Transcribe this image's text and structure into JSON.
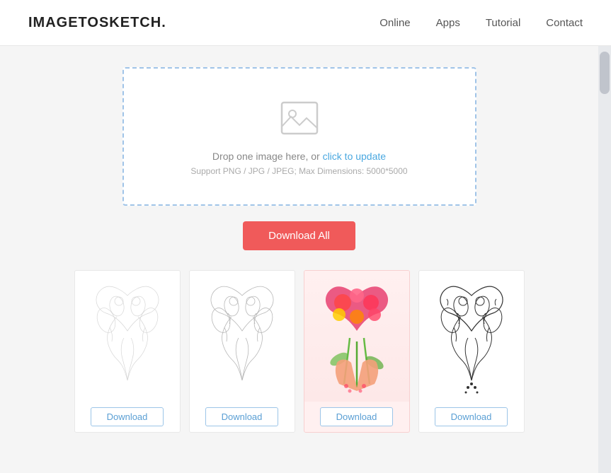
{
  "header": {
    "logo": "IMAGETOSKETCH.",
    "nav": [
      {
        "label": "Online",
        "href": "#"
      },
      {
        "label": "Apps",
        "href": "#"
      },
      {
        "label": "Tutorial",
        "href": "#"
      },
      {
        "label": "Contact",
        "href": "#"
      }
    ]
  },
  "dropzone": {
    "main_text": "Drop one image here, or ",
    "link_text": "click to update",
    "sub_text": "Support PNG / JPG / JPEG; Max Dimensions: 5000*5000"
  },
  "buttons": {
    "download_all": "Download All",
    "download": "Download"
  },
  "thumbnails": [
    {
      "id": 1,
      "type": "light-sketch",
      "highlighted": false
    },
    {
      "id": 2,
      "type": "medium-sketch",
      "highlighted": false
    },
    {
      "id": 3,
      "type": "color",
      "highlighted": true
    },
    {
      "id": 4,
      "type": "dark-sketch",
      "highlighted": false
    }
  ]
}
